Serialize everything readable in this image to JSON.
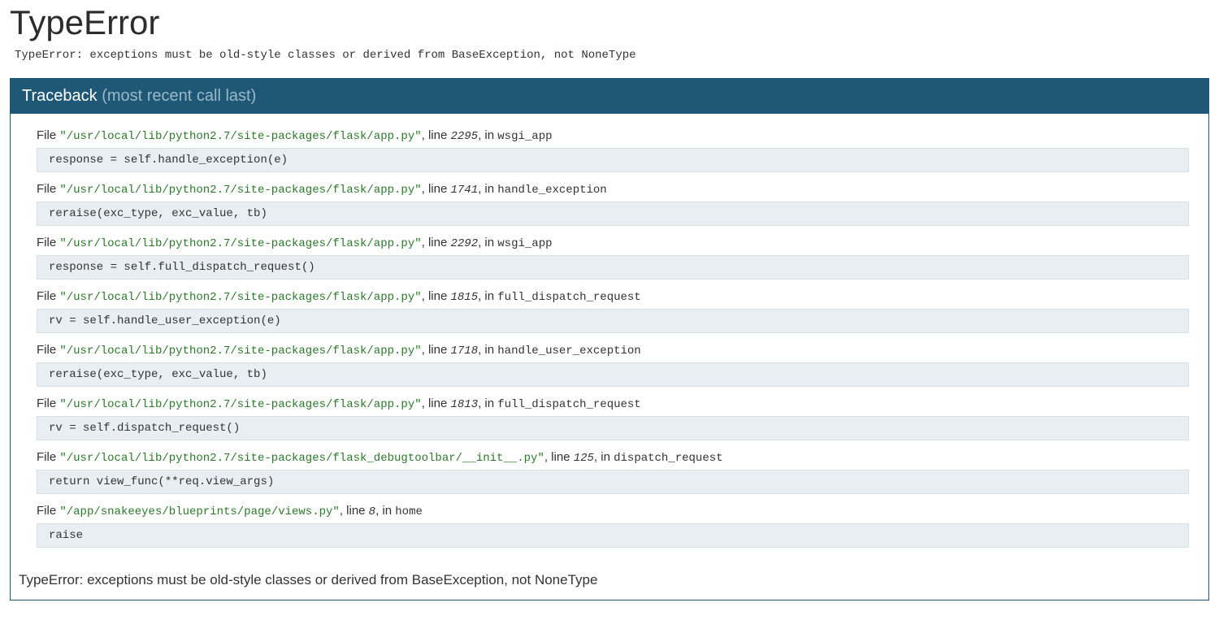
{
  "error_title": "TypeError",
  "error_message": "TypeError: exceptions must be old-style classes or derived from BaseException, not NoneType",
  "traceback_header_prefix": "Traceback ",
  "traceback_header_suffix": "(most recent call last)",
  "frames": [
    {
      "file_quoted": "\"/usr/local/lib/python2.7/site-packages/flask/app.py\"",
      "lineno": "2295",
      "fn": "wsgi_app",
      "code": "response = self.handle_exception(e)"
    },
    {
      "file_quoted": "\"/usr/local/lib/python2.7/site-packages/flask/app.py\"",
      "lineno": "1741",
      "fn": "handle_exception",
      "code": "reraise(exc_type, exc_value, tb)"
    },
    {
      "file_quoted": "\"/usr/local/lib/python2.7/site-packages/flask/app.py\"",
      "lineno": "2292",
      "fn": "wsgi_app",
      "code": "response = self.full_dispatch_request()"
    },
    {
      "file_quoted": "\"/usr/local/lib/python2.7/site-packages/flask/app.py\"",
      "lineno": "1815",
      "fn": "full_dispatch_request",
      "code": "rv = self.handle_user_exception(e)"
    },
    {
      "file_quoted": "\"/usr/local/lib/python2.7/site-packages/flask/app.py\"",
      "lineno": "1718",
      "fn": "handle_user_exception",
      "code": "reraise(exc_type, exc_value, tb)"
    },
    {
      "file_quoted": "\"/usr/local/lib/python2.7/site-packages/flask/app.py\"",
      "lineno": "1813",
      "fn": "full_dispatch_request",
      "code": "rv = self.dispatch_request()"
    },
    {
      "file_quoted": "\"/usr/local/lib/python2.7/site-packages/flask_debugtoolbar/__init__.py\"",
      "lineno": "125",
      "fn": "dispatch_request",
      "code": "return view_func(**req.view_args)"
    },
    {
      "file_quoted": "\"/app/snakeeyes/blueprints/page/views.py\"",
      "lineno": "8",
      "fn": "home",
      "code": "raise"
    }
  ],
  "bottom_error": "TypeError: exceptions must be old-style classes or derived from BaseException, not NoneType",
  "labels": {
    "file": "File ",
    "line": ", line ",
    "in": ", in "
  }
}
